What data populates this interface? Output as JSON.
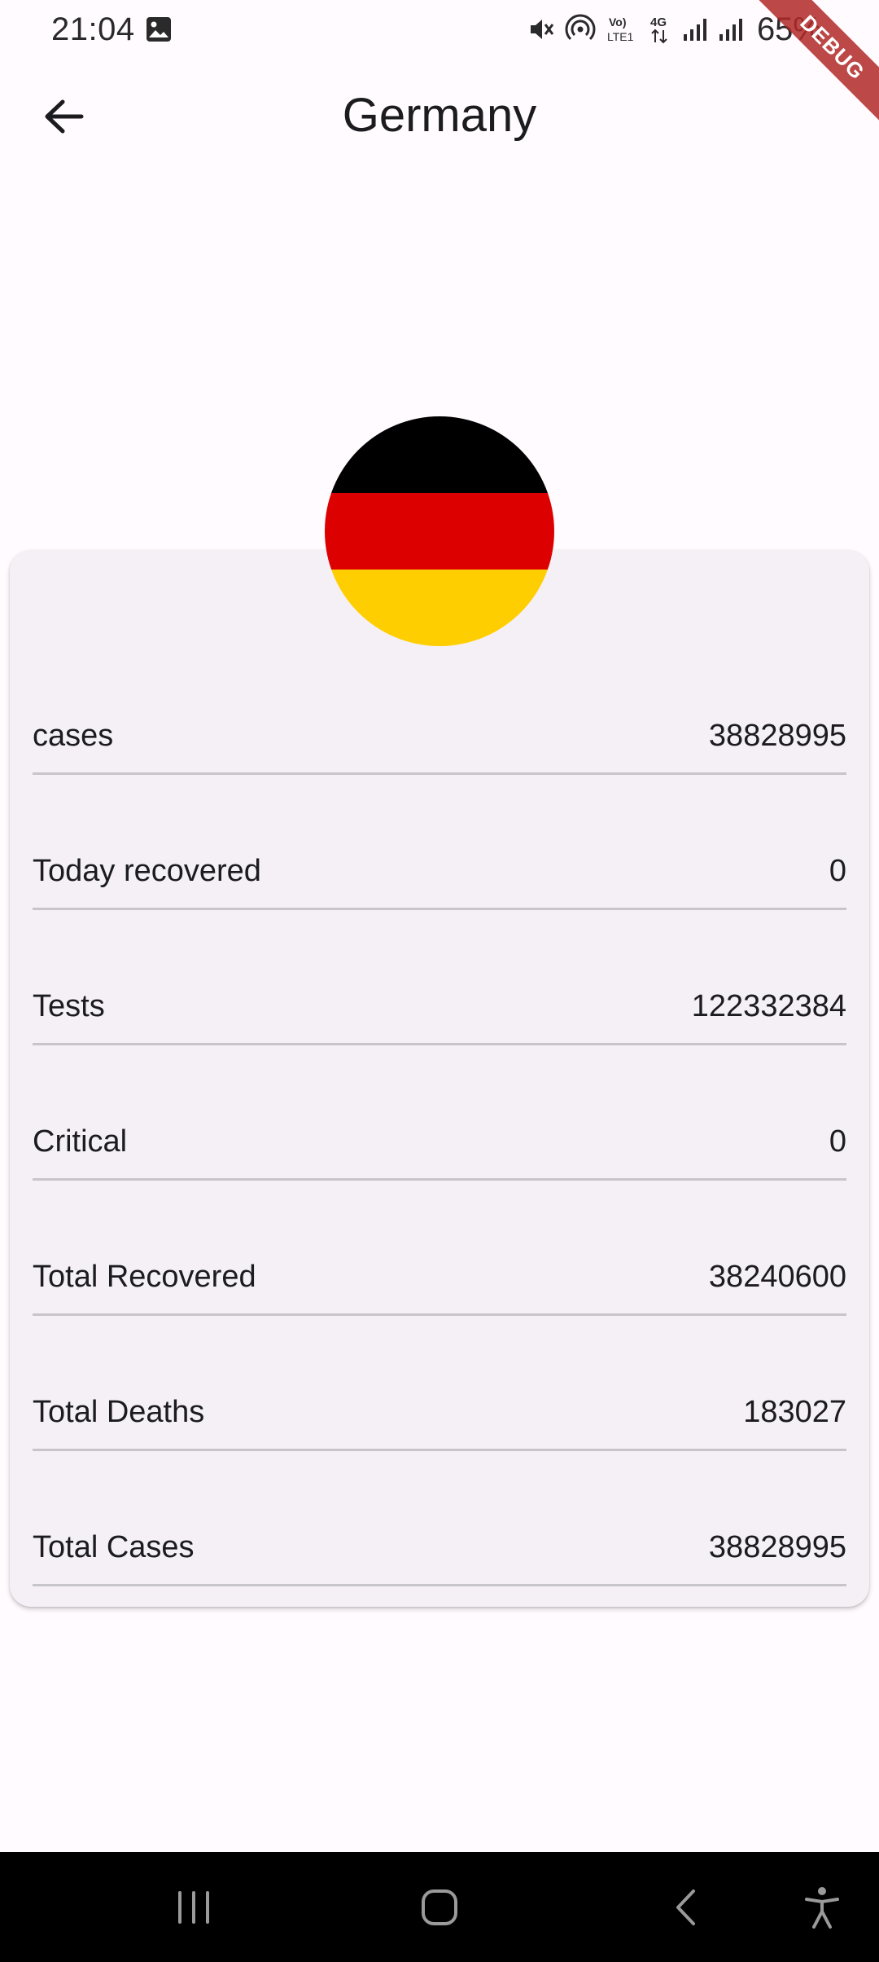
{
  "status_bar": {
    "time": "21:04",
    "battery": "65%",
    "icons": [
      "gallery-icon",
      "mute-icon",
      "hotspot-icon",
      "volte-icon",
      "4g-icon",
      "signal-icon",
      "signal-icon",
      "battery-icon"
    ]
  },
  "debug_banner": "DEBUG",
  "app_bar": {
    "title": "Germany",
    "back_icon": "arrow-back-icon"
  },
  "flag": {
    "country": "Germany",
    "stripes": [
      "#000000",
      "#dd0000",
      "#ffce00"
    ]
  },
  "stats": [
    {
      "label": "cases",
      "value": "38828995"
    },
    {
      "label": "Today recovered",
      "value": "0"
    },
    {
      "label": "Tests",
      "value": "122332384"
    },
    {
      "label": "Critical",
      "value": "0"
    },
    {
      "label": "Total Recovered",
      "value": "38240600"
    },
    {
      "label": "Total Deaths",
      "value": "183027"
    },
    {
      "label": "Total Cases",
      "value": "38828995"
    }
  ],
  "nav_bar": {
    "buttons": [
      "recent-apps-icon",
      "home-icon",
      "back-icon",
      "accessibility-icon"
    ]
  },
  "colors": {
    "background": "#fffbfe",
    "card": "#f4f0f6",
    "divider": "#c7c5ca",
    "debug_ribbon": "#b02828"
  }
}
